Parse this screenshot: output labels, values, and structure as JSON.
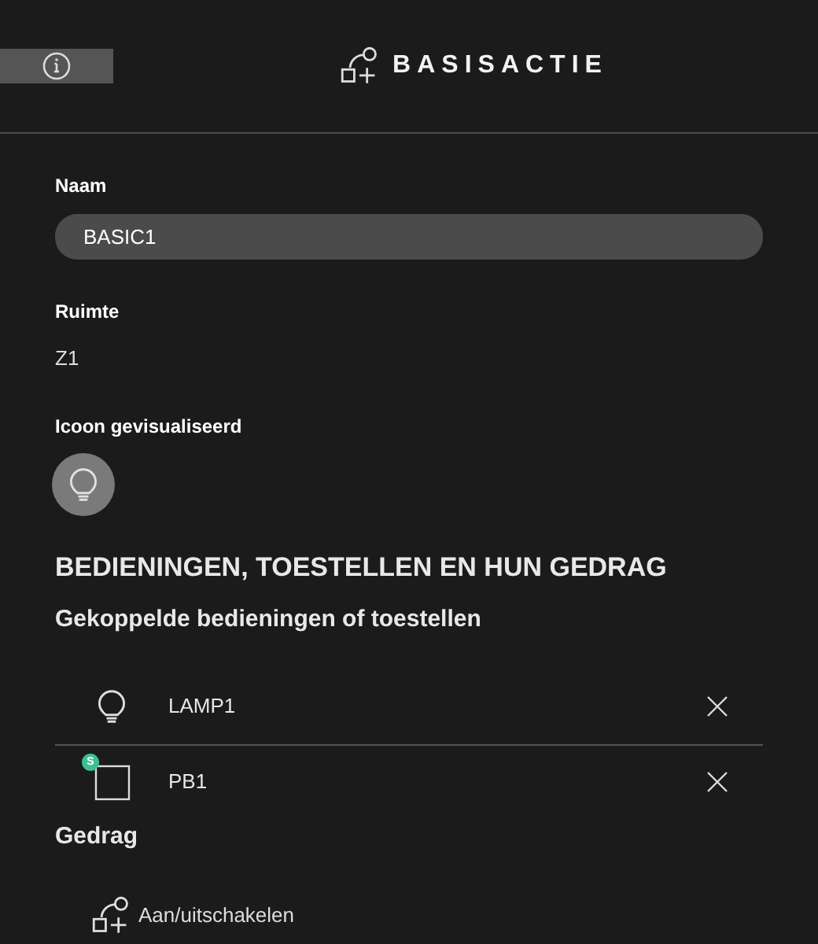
{
  "header": {
    "title": "BASISACTIE"
  },
  "name_field": {
    "label": "Naam",
    "value": "BASIC1"
  },
  "room": {
    "label": "Ruimte",
    "value": "Z1"
  },
  "icon_setting": {
    "label": "Icoon gevisualiseerd"
  },
  "section_title": "BEDIENINGEN, TOESTELLEN EN HUN GEDRAG",
  "linked": {
    "title": "Gekoppelde bedieningen of toestellen",
    "items": [
      {
        "kind": "lamp",
        "label": "LAMP1"
      },
      {
        "kind": "pushbutton",
        "label": "PB1",
        "badge": "S"
      }
    ]
  },
  "behaviour": {
    "title": "Gedrag",
    "items": [
      {
        "label": "Aan/uitschakelen"
      }
    ]
  }
}
